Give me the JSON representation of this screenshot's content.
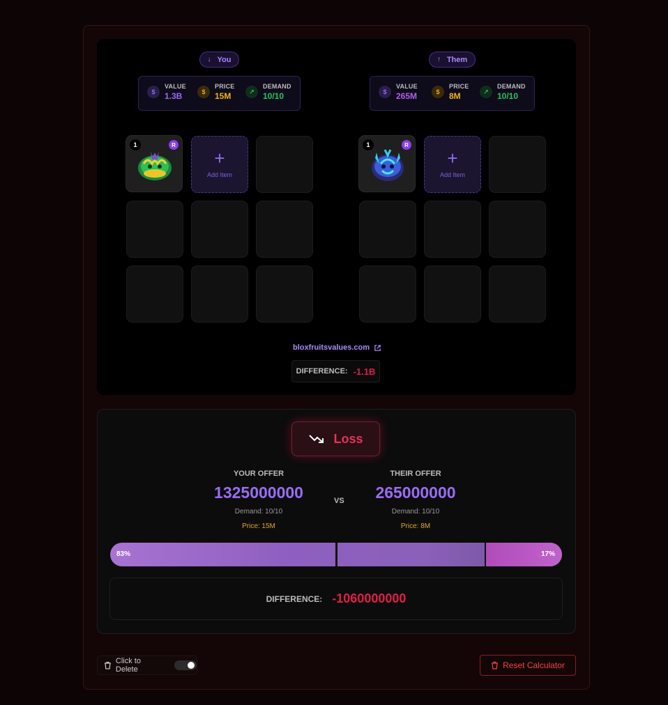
{
  "you": {
    "tag": "You",
    "stats": {
      "value_label": "VALUE",
      "value": "1.3B",
      "price_label": "PRICE",
      "price": "15M",
      "demand_label": "DEMAND",
      "demand": "10/10"
    },
    "items": [
      {
        "qty": "1",
        "rarity": "R",
        "icon": "green-fruit-icon"
      }
    ],
    "add_label": "Add Item"
  },
  "them": {
    "tag": "Them",
    "stats": {
      "value_label": "VALUE",
      "value": "265M",
      "price_label": "PRICE",
      "price": "8M",
      "demand_label": "DEMAND",
      "demand": "10/10"
    },
    "items": [
      {
        "qty": "1",
        "rarity": "R",
        "icon": "blue-fruit-icon"
      }
    ],
    "add_label": "Add Item"
  },
  "site_link": "bloxfruitsvalues.com",
  "difference_small": {
    "label": "DIFFERENCE:",
    "value": "-1.1B"
  },
  "result": {
    "verdict": "Loss",
    "your_offer": {
      "label": "YOUR OFFER",
      "value": "1325000000",
      "demand": "Demand: 10/10",
      "price": "Price: 15M"
    },
    "vs": "VS",
    "their_offer": {
      "label": "THEIR OFFER",
      "value": "265000000",
      "demand": "Demand: 10/10",
      "price": "Price: 8M"
    },
    "bar": {
      "you_percent": 83,
      "them_percent": 17,
      "you_label": "83%",
      "them_label": "17%"
    },
    "difference": {
      "label": "DIFFERENCE:",
      "value": "-1060000000"
    }
  },
  "footer": {
    "delete_label": "Click to Delete",
    "delete_toggle_on": true,
    "reset_label": "Reset Calculator"
  },
  "colors": {
    "accent_purple": "#9b6cf5",
    "loss_red": "#e11d48",
    "price_gold": "#f0b41a",
    "demand_green": "#22c55e"
  }
}
